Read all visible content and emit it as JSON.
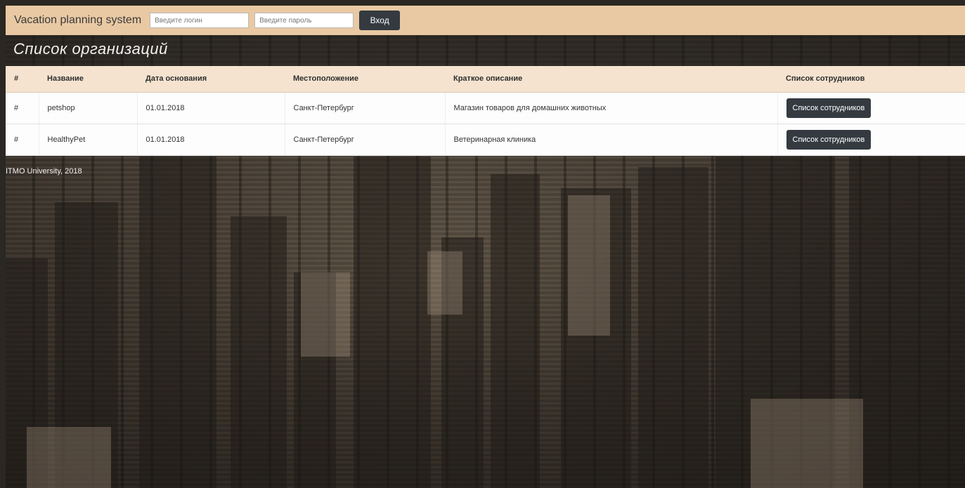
{
  "navbar": {
    "brand": "Vacation planning system",
    "login_placeholder": "Введите логин",
    "password_placeholder": "Введите пароль",
    "login_button": "Вход"
  },
  "page": {
    "title": "Список организаций"
  },
  "table": {
    "headers": [
      "#",
      "Название",
      "Дата основания",
      "Местоположение",
      "Краткое описание",
      "Список сотрудников"
    ],
    "rows": [
      {
        "num": "#",
        "name": "petshop",
        "founded": "01.01.2018",
        "location": "Санкт-Петербург",
        "description": "Магазин товаров для домашних животных",
        "button": "Список сотрудников"
      },
      {
        "num": "#",
        "name": "HealthyPet",
        "founded": "01.01.2018",
        "location": "Санкт-Петербург",
        "description": "Ветеринарная клиника",
        "button": "Список сотрудников"
      }
    ]
  },
  "footer": {
    "text": "ITMO University, 2018"
  },
  "colors": {
    "navbar_bg": "#e9c9a3",
    "header_row_bg": "#f5e3cf",
    "button_bg": "#343a40"
  }
}
